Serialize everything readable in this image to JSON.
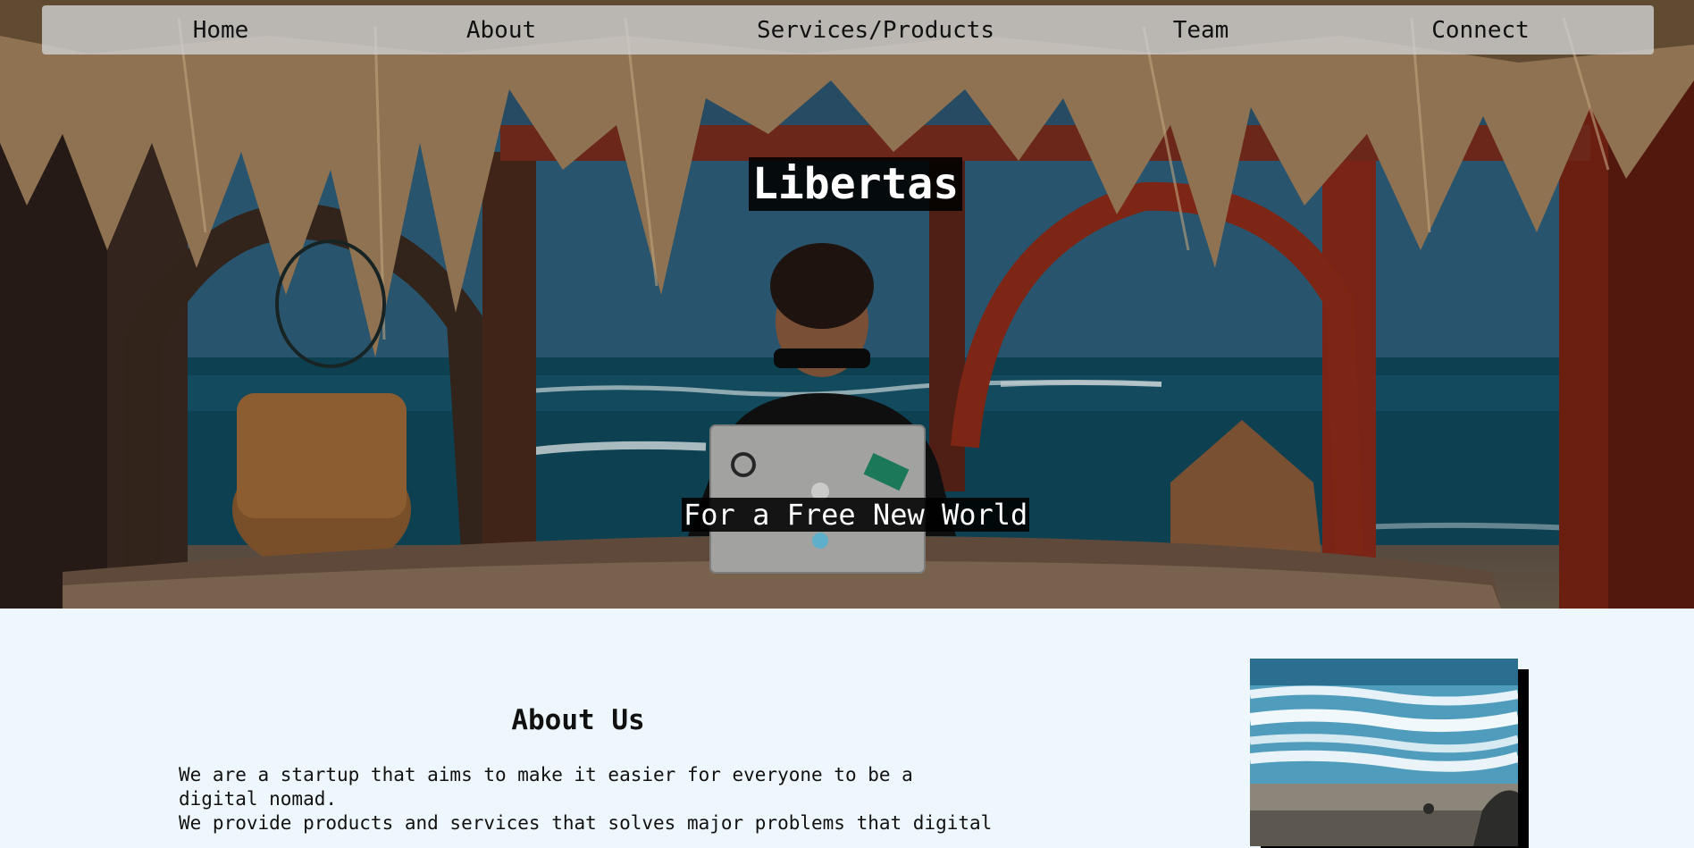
{
  "nav": {
    "items": [
      {
        "label": "Home"
      },
      {
        "label": "About"
      },
      {
        "label": "Services/Products"
      },
      {
        "label": "Team"
      },
      {
        "label": "Connect"
      }
    ]
  },
  "hero": {
    "title": "Libertas",
    "subtitle": "For a Free New World"
  },
  "about": {
    "heading": "About Us",
    "line1": "We are a startup that aims to make it easier for everyone to be a",
    "line2": "digital nomad.",
    "line3": "We provide products and services that solves major problems that digital"
  }
}
